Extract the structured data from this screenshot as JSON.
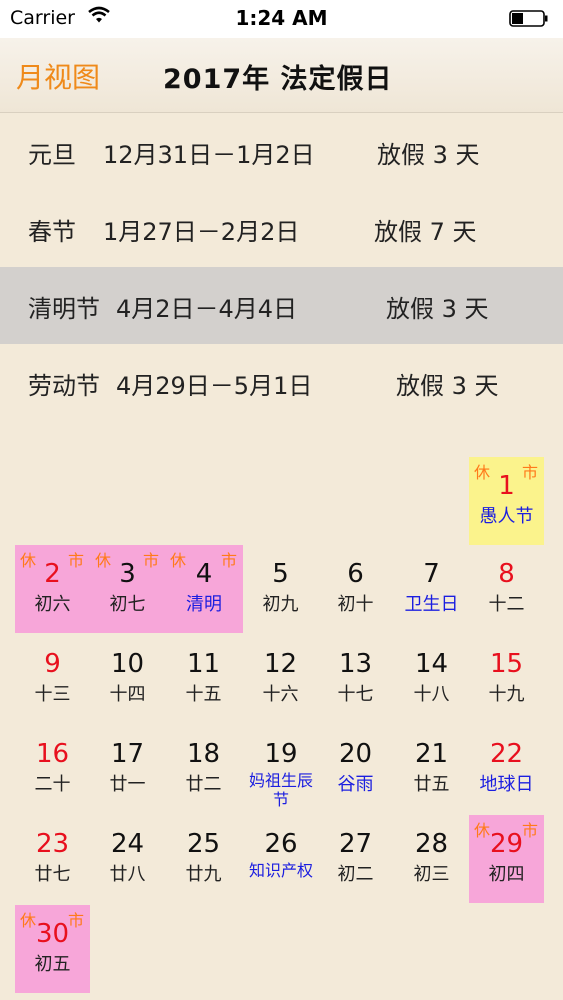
{
  "status_bar": {
    "carrier": "Carrier",
    "time": "1:24 AM"
  },
  "nav": {
    "back_label": "月视图",
    "title": "2017年  法定假日"
  },
  "holidays": [
    {
      "name": "元旦",
      "dates": "12月31日－1月2日",
      "off": "放假 3 天"
    },
    {
      "name": "春节",
      "dates": "1月27日－2月2日",
      "off": "放假 7 天"
    },
    {
      "name": "清明节",
      "dates": "4月2日－4月4日",
      "off": "放假 3 天"
    },
    {
      "name": "劳动节",
      "dates": "4月29日－5月1日",
      "off": "放假 3 天"
    }
  ],
  "calendar": {
    "rest_tag": "休",
    "market_tag": "市",
    "days": [
      {
        "num": "1",
        "sub": "愚人节"
      },
      {
        "num": "2",
        "sub": "初六"
      },
      {
        "num": "3",
        "sub": "初七"
      },
      {
        "num": "4",
        "sub": "清明"
      },
      {
        "num": "5",
        "sub": "初九"
      },
      {
        "num": "6",
        "sub": "初十"
      },
      {
        "num": "7",
        "sub": "卫生日"
      },
      {
        "num": "8",
        "sub": "十二"
      },
      {
        "num": "9",
        "sub": "十三"
      },
      {
        "num": "10",
        "sub": "十四"
      },
      {
        "num": "11",
        "sub": "十五"
      },
      {
        "num": "12",
        "sub": "十六"
      },
      {
        "num": "13",
        "sub": "十七"
      },
      {
        "num": "14",
        "sub": "十八"
      },
      {
        "num": "15",
        "sub": "十九"
      },
      {
        "num": "16",
        "sub": "二十"
      },
      {
        "num": "17",
        "sub": "廿一"
      },
      {
        "num": "18",
        "sub": "廿二"
      },
      {
        "num": "19",
        "sub": "妈祖生辰节"
      },
      {
        "num": "20",
        "sub": "谷雨"
      },
      {
        "num": "21",
        "sub": "廿五"
      },
      {
        "num": "22",
        "sub": "地球日"
      },
      {
        "num": "23",
        "sub": "廿七"
      },
      {
        "num": "24",
        "sub": "廿八"
      },
      {
        "num": "25",
        "sub": "廿九"
      },
      {
        "num": "26",
        "sub": "知识产权"
      },
      {
        "num": "27",
        "sub": "初二"
      },
      {
        "num": "28",
        "sub": "初三"
      },
      {
        "num": "29",
        "sub": "初四"
      },
      {
        "num": "30",
        "sub": "初五"
      }
    ]
  }
}
